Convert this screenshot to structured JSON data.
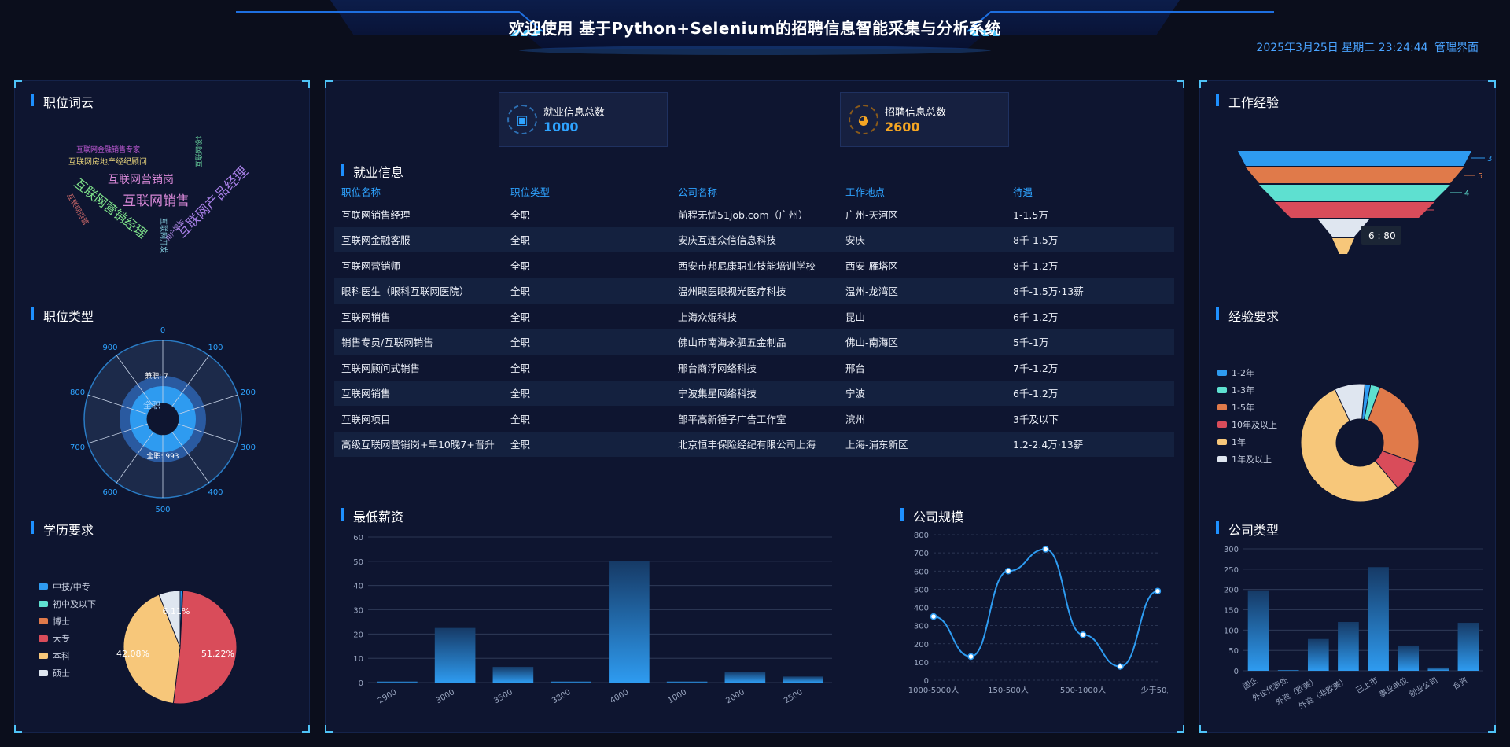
{
  "header": {
    "title": "欢迎使用 基于Python+Selenium的招聘信息智能采集与分析系统",
    "datetime": "2025年3月25日 星期二 23:24:44",
    "admin_link": "管理界面"
  },
  "left": {
    "wordcloud_title": "职位词云",
    "wordcloud_words": [
      {
        "text": "互联网金融销售专家",
        "color": "#c05ad6"
      },
      {
        "text": "互联网房地产经纪顾问",
        "color": "#e6d27a"
      },
      {
        "text": "互联网营销岗",
        "color": "#d687d6"
      },
      {
        "text": "互联网销售",
        "color": "#d687d6"
      },
      {
        "text": "互联网营销经理",
        "color": "#7ee28a"
      },
      {
        "text": "互联网产品经理",
        "color": "#a77fe6"
      },
      {
        "text": "互联网运营",
        "color": "#cf6a6a"
      },
      {
        "text": "互联网设计",
        "color": "#6ad6a0"
      },
      {
        "text": "互联网开发",
        "color": "#8ad6e6"
      },
      {
        "text": "用户增长",
        "color": "#b08ae6"
      }
    ],
    "jobtype_title": "职位类型",
    "jobtype_chart": {
      "type": "polar-bar",
      "ticks": [
        "0",
        "100",
        "200",
        "300",
        "400",
        "500",
        "600",
        "700",
        "800",
        "900"
      ],
      "series": [
        {
          "name": "全职",
          "value": 993
        },
        {
          "name": "兼职",
          "value": 7
        }
      ],
      "labels": {
        "outer": "兼职: 7",
        "mid": "全职",
        "inner": "全职: 993"
      }
    },
    "edu_title": "学历要求",
    "edu_legend": [
      {
        "name": "中技/中专",
        "color": "#2e9bf0"
      },
      {
        "name": "初中及以下",
        "color": "#5ee0d0"
      },
      {
        "name": "博士",
        "color": "#e07a4a"
      },
      {
        "name": "大专",
        "color": "#d94c5a"
      },
      {
        "name": "本科",
        "color": "#f7c77a"
      },
      {
        "name": "硕士",
        "color": "#dfe6f0"
      }
    ],
    "edu_labels": {
      "a": "6.11%",
      "b": "51.22%",
      "c": "42.08%"
    }
  },
  "center": {
    "stat1": {
      "label": "就业信息总数",
      "value": "1000"
    },
    "stat2": {
      "label": "招聘信息总数",
      "value": "2600"
    },
    "table_title": "就业信息",
    "table_headers": [
      "职位名称",
      "职位类型",
      "公司名称",
      "工作地点",
      "待遇"
    ],
    "table_rows": [
      [
        "互联网销售经理",
        "全职",
        "前程无忧51job.com（广州）",
        "广州-天河区",
        "1-1.5万"
      ],
      [
        "互联网金融客服",
        "全职",
        "安庆互连众信信息科技",
        "安庆",
        "8千-1.5万"
      ],
      [
        "互联网营销师",
        "全职",
        "西安市邦尼康职业技能培训学校",
        "西安-雁塔区",
        "8千-1.2万"
      ],
      [
        "眼科医生（眼科互联网医院）",
        "全职",
        "温州眼医眼视光医疗科技",
        "温州-龙湾区",
        "8千-1.5万·13薪"
      ],
      [
        "互联网销售",
        "全职",
        "上海众焜科技",
        "昆山",
        "6千-1.2万"
      ],
      [
        "销售专员/互联网销售",
        "全职",
        "佛山市南海永驷五金制品",
        "佛山-南海区",
        "5千-1万"
      ],
      [
        "互联网顾问式销售",
        "全职",
        "邢台商浮网络科技",
        "邢台",
        "7千-1.2万"
      ],
      [
        "互联网销售",
        "全职",
        "宁波集星网络科技",
        "宁波",
        "6千-1.2万"
      ],
      [
        "互联网项目",
        "全职",
        "邹平高新锤子广告工作室",
        "滨州",
        "3千及以下"
      ],
      [
        "高级互联网营销岗+早10晚7+晋升",
        "全职",
        "北京恒丰保险经纪有限公司上海",
        "上海-浦东新区",
        "1.2-2.4万·13薪"
      ]
    ],
    "minsalary_title": "最低薪资",
    "companysize_title": "公司规模"
  },
  "right": {
    "exp_title": "工作经验",
    "funnel_tooltip": "6 : 80",
    "funnel_labels": [
      "3",
      "5",
      "4",
      "6"
    ],
    "expreq_title": "经验要求",
    "expreq_legend": [
      {
        "name": "1-2年",
        "color": "#2e9bf0"
      },
      {
        "name": "1-3年",
        "color": "#5ee0d0"
      },
      {
        "name": "1-5年",
        "color": "#e07a4a"
      },
      {
        "name": "10年及以上",
        "color": "#d94c5a"
      },
      {
        "name": "1年",
        "color": "#f7c77a"
      },
      {
        "name": "1年及以上",
        "color": "#dfe6f0"
      }
    ],
    "companytype_title": "公司类型"
  },
  "chart_data": [
    {
      "type": "bar",
      "title": "最低薪资",
      "categories": [
        "2900",
        "3000",
        "3500",
        "3800",
        "4000",
        "1000",
        "2000",
        "2500"
      ],
      "values": [
        0.5,
        22.5,
        6.5,
        0.5,
        50,
        0.5,
        4.5,
        2.5
      ],
      "ylim": [
        0,
        60
      ],
      "yticks": [
        "0",
        "10",
        "20",
        "30",
        "40",
        "50",
        "60"
      ]
    },
    {
      "type": "line",
      "title": "公司规模",
      "categories": [
        "1000-5000人",
        "",
        "150-500人",
        "",
        "500-1000人",
        "",
        "少于50人"
      ],
      "values": [
        350,
        130,
        600,
        720,
        250,
        75,
        490
      ],
      "ylim": [
        0,
        800
      ],
      "yticks": [
        "0",
        "100",
        "200",
        "300",
        "400",
        "500",
        "600",
        "700",
        "800"
      ],
      "xlabels": [
        "1000-5000人",
        "150-500人",
        "500-1000人",
        "少于50人"
      ]
    },
    {
      "type": "bar",
      "title": "公司类型",
      "categories": [
        "国企",
        "外企代表处",
        "外资（欧美）",
        "外资（非欧美）",
        "已上市",
        "事业单位",
        "创业公司",
        "合资"
      ],
      "values": [
        198,
        2,
        78,
        120,
        255,
        62,
        8,
        118
      ],
      "ylim": [
        0,
        300
      ],
      "yticks": [
        "0",
        "50",
        "100",
        "150",
        "200",
        "250",
        "300"
      ]
    },
    {
      "type": "pie",
      "title": "学历要求",
      "series": [
        {
          "name": "中技/中专",
          "value": 0.6,
          "color": "#2e9bf0"
        },
        {
          "name": "初中及以下",
          "value": 0.1,
          "color": "#5ee0d0"
        },
        {
          "name": "博士",
          "value": 0.1,
          "color": "#e07a4a"
        },
        {
          "name": "大专",
          "value": 51.22,
          "color": "#d94c5a"
        },
        {
          "name": "本科",
          "value": 42.08,
          "color": "#f7c77a"
        },
        {
          "name": "硕士",
          "value": 6.11,
          "color": "#dfe6f0"
        }
      ]
    },
    {
      "type": "pie",
      "title": "经验要求",
      "series": [
        {
          "name": "1-2年",
          "value": 1.5,
          "color": "#2e9bf0"
        },
        {
          "name": "1-3年",
          "value": 2.5,
          "color": "#5ee0d0"
        },
        {
          "name": "1-5年",
          "value": 24,
          "color": "#e07a4a"
        },
        {
          "name": "10年及以上",
          "value": 8,
          "color": "#d94c5a"
        },
        {
          "name": "1年",
          "value": 52,
          "color": "#f7c77a"
        },
        {
          "name": "1年及以上",
          "value": 8,
          "color": "#dfe6f0"
        }
      ]
    }
  ]
}
